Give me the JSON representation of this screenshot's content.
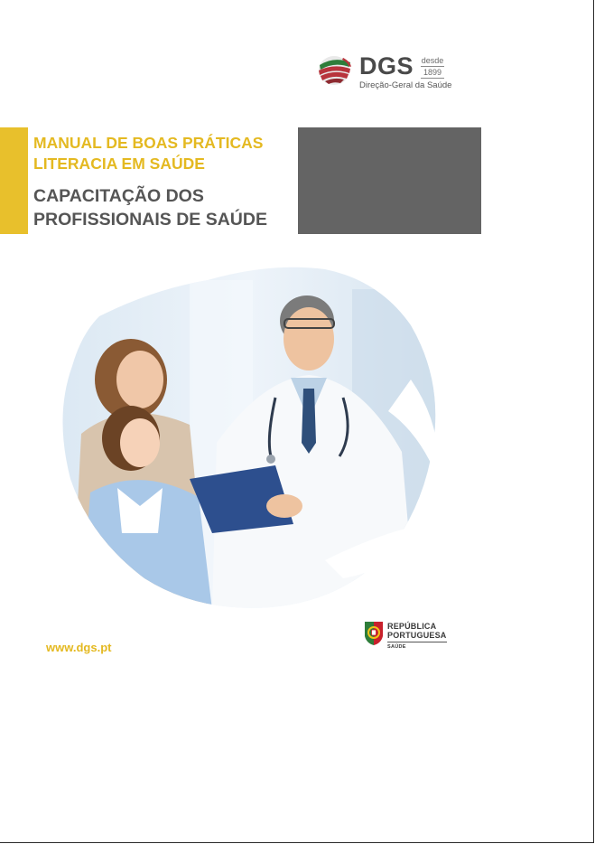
{
  "header": {
    "logo": {
      "name": "DGS",
      "since_label": "desde",
      "since_year": "1899",
      "subtitle": "Direção-Geral da Saúde",
      "colors": {
        "red": "#b8343c",
        "green": "#2e7d3a",
        "text": "#4a4a4a"
      }
    }
  },
  "cover": {
    "series_title": "MANUAL DE BOAS PRÁTICAS LITERACIA EM SAÚDE",
    "main_title": "CAPACITAÇÃO DOS PROFISSIONAIS DE SAÚDE",
    "accent_color": "#e8c02c",
    "box_color": "#646464",
    "photo_icon": "doctor-with-mother-and-child-photo"
  },
  "footer": {
    "website": "www.dgs.pt",
    "government_logo": {
      "line1": "REPÚBLICA",
      "line2": "PORTUGUESA",
      "department": "SAÚDE"
    }
  }
}
